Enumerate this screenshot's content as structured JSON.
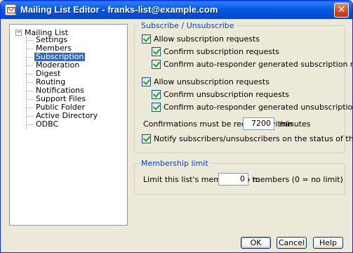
{
  "window": {
    "title": "Mailing List Editor - franks-list@example.com",
    "close_glyph": "✕"
  },
  "tree": {
    "expander_glyph": "−",
    "root": "Mailing List",
    "items": [
      {
        "label": "Settings"
      },
      {
        "label": "Members"
      },
      {
        "label": "Subscription",
        "selected": true
      },
      {
        "label": "Moderation"
      },
      {
        "label": "Digest"
      },
      {
        "label": "Routing"
      },
      {
        "label": "Notifications"
      },
      {
        "label": "Support Files"
      },
      {
        "label": "Public Folder"
      },
      {
        "label": "Active Directory"
      },
      {
        "label": "ODBC"
      }
    ]
  },
  "subscribe_group": {
    "title": "Subscribe / Unsubscribe",
    "allow_sub": {
      "label": "Allow subscription requests",
      "checked": true
    },
    "confirm_sub": {
      "label": "Confirm subscription requests",
      "checked": true
    },
    "confirm_auto_sub": {
      "label": "Confirm auto-responder generated subscription requests",
      "checked": true
    },
    "allow_unsub": {
      "label": "Allow unsubscription requests",
      "checked": true
    },
    "confirm_unsub": {
      "label": "Confirm unsubscription requests",
      "checked": true
    },
    "confirm_auto_unsub": {
      "label": "Confirm auto-responder generated unsubscription requests",
      "checked": true
    },
    "confirm_within_label": "Confirmations must be received within",
    "confirm_within_value": "7200",
    "confirm_within_unit": "minutes",
    "notify": {
      "label": "Notify subscribers/unsubscribers on the status of their requests",
      "checked": true
    }
  },
  "membership_group": {
    "title": "Membership limit",
    "limit_label": "Limit this list's membership to",
    "limit_value": "0",
    "limit_unit": "members (0 = no limit)"
  },
  "buttons": {
    "ok": "OK",
    "cancel": "Cancel",
    "help": "Help"
  }
}
